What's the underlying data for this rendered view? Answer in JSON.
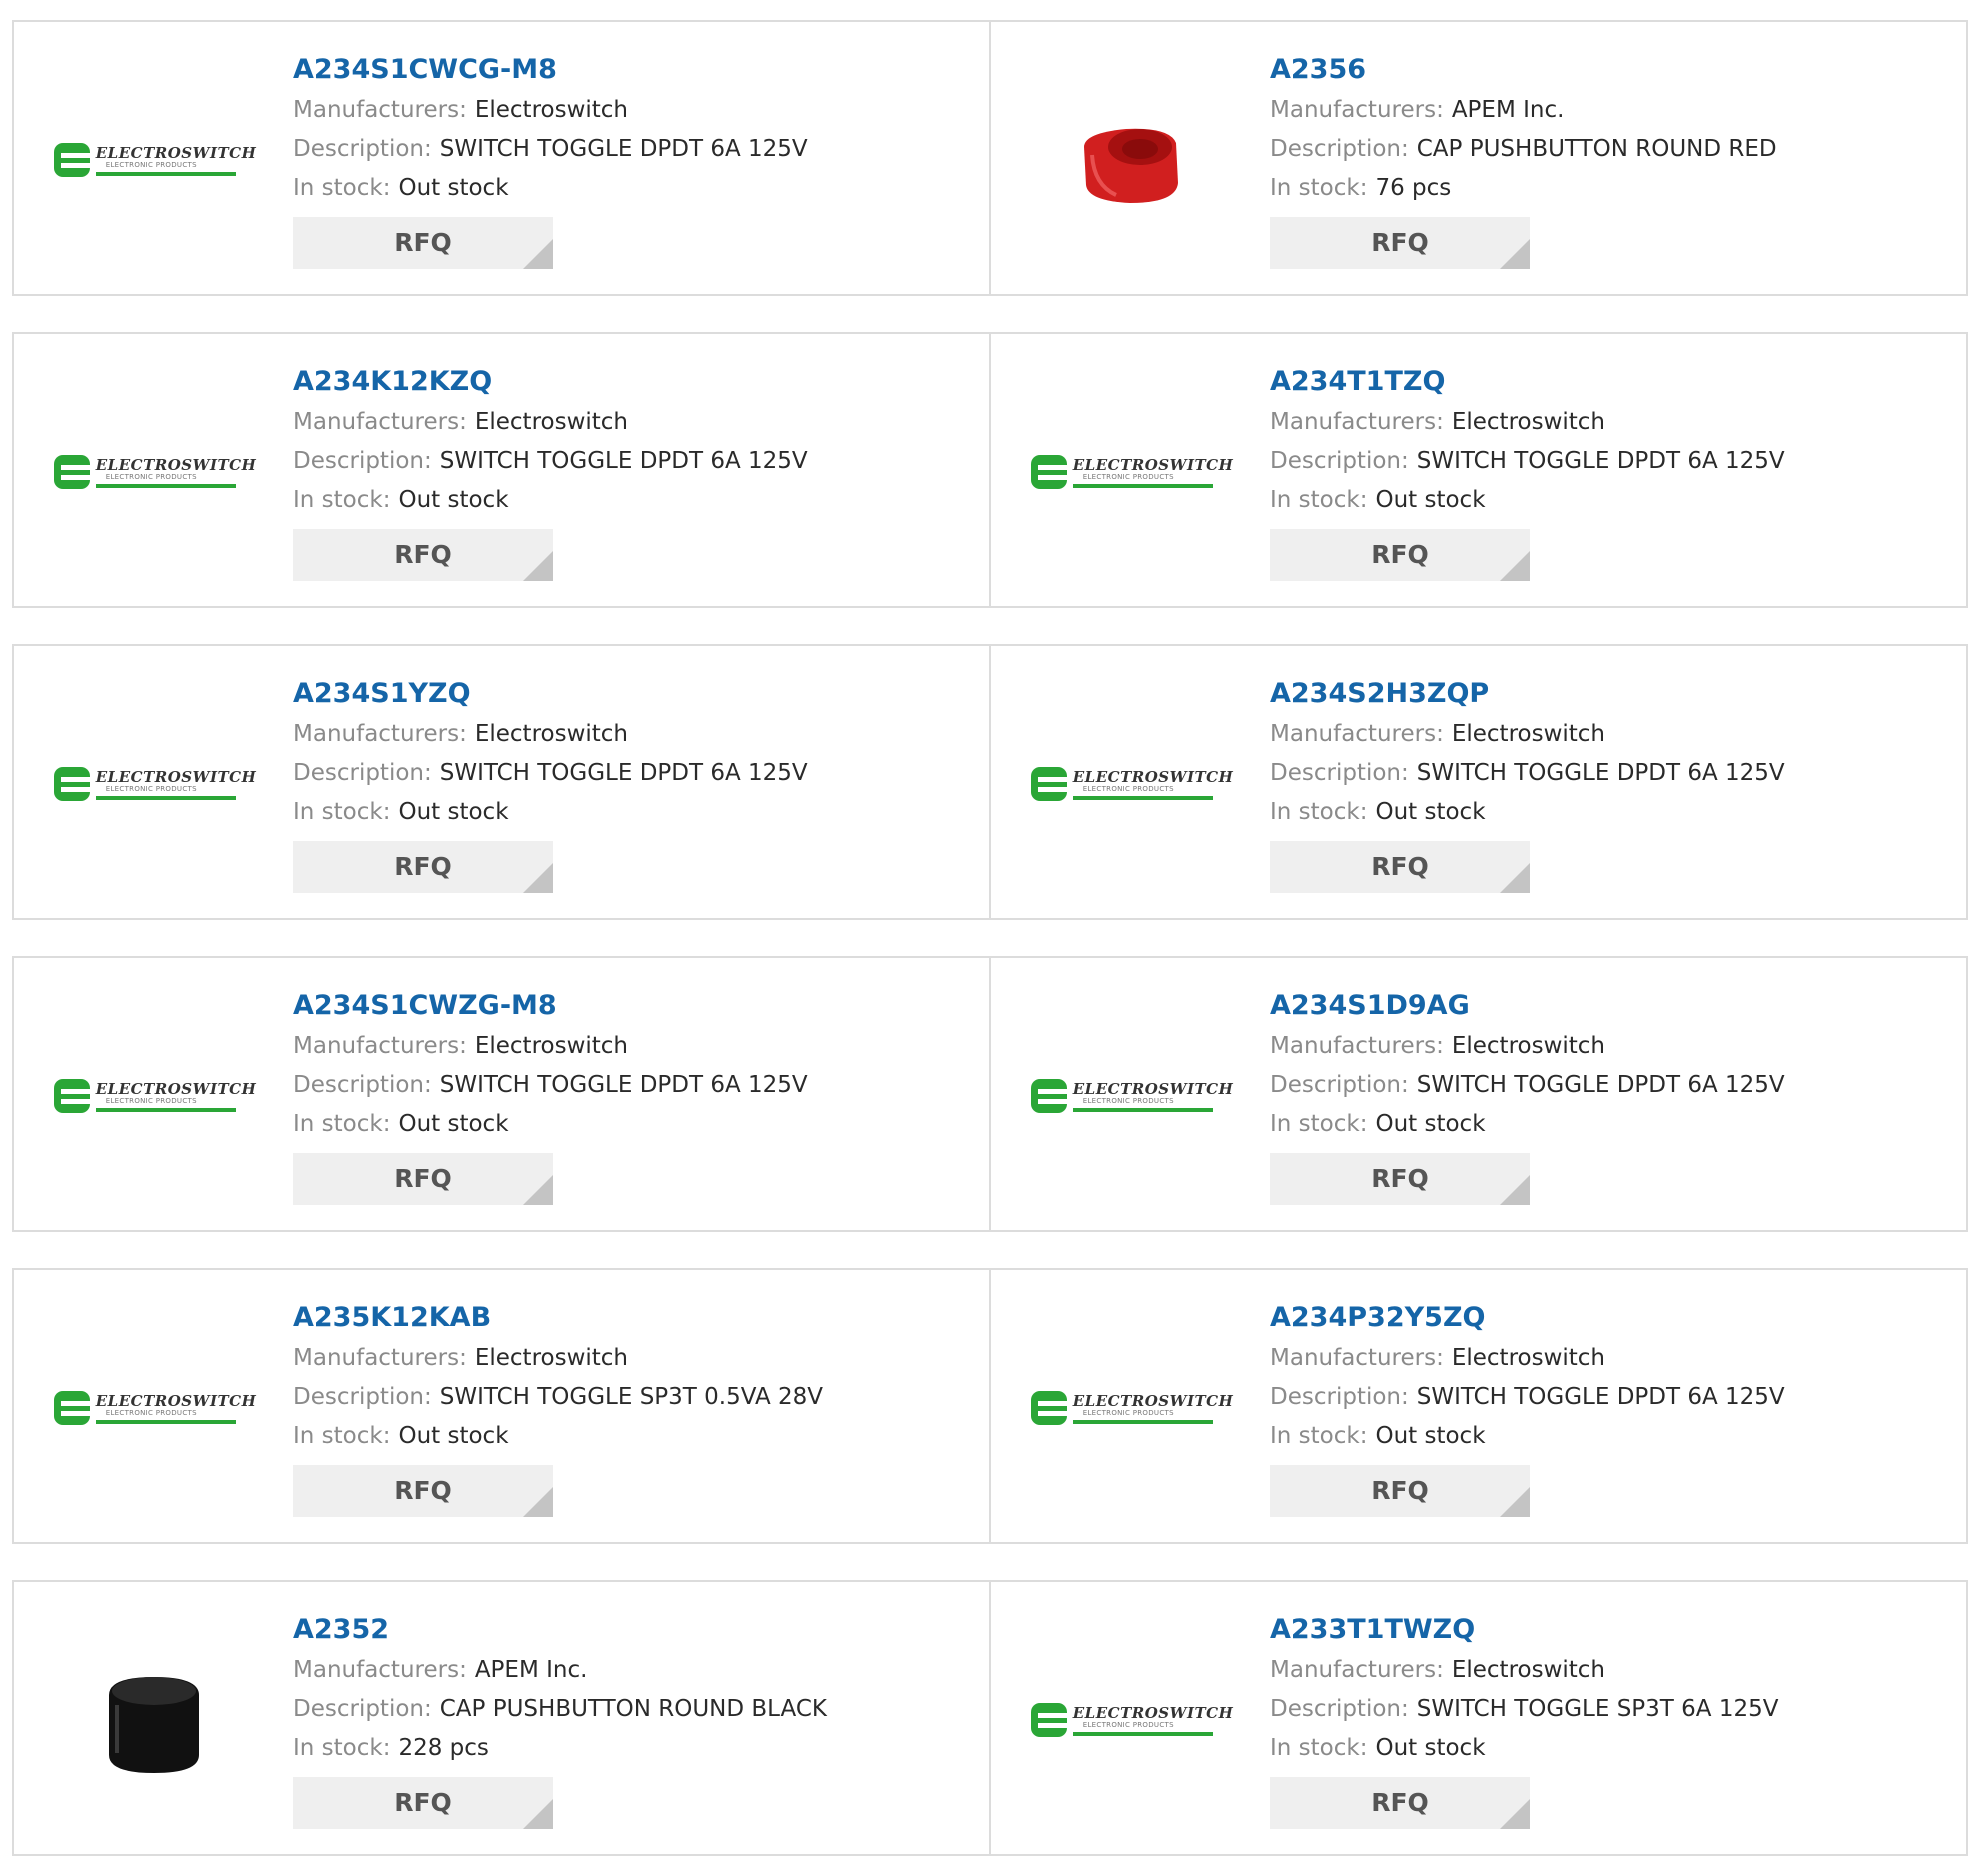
{
  "labels": {
    "manufacturers": "Manufacturers:",
    "description": "Description:",
    "in_stock": "In stock:",
    "rfq": "RFQ",
    "logo_word": "ELECTROSWITCH",
    "logo_sub": "ELECTRONIC PRODUCTS"
  },
  "colors": {
    "link": "#1565a8",
    "logo_green": "#2aa636",
    "red_cap": "#d11f1f",
    "black_cap": "#111111"
  },
  "products": [
    {
      "part": "A234S1CWCG-M8",
      "manufacturer": "Electroswitch",
      "description": "SWITCH TOGGLE DPDT 6A 125V",
      "stock": "Out stock",
      "image": "electroswitch-logo"
    },
    {
      "part": "A2356",
      "manufacturer": "APEM Inc.",
      "description": "CAP PUSHBUTTON ROUND RED",
      "stock": "76 pcs",
      "image": "red-cap"
    },
    {
      "part": "A234K12KZQ",
      "manufacturer": "Electroswitch",
      "description": "SWITCH TOGGLE DPDT 6A 125V",
      "stock": "Out stock",
      "image": "electroswitch-logo"
    },
    {
      "part": "A234T1TZQ",
      "manufacturer": "Electroswitch",
      "description": "SWITCH TOGGLE DPDT 6A 125V",
      "stock": "Out stock",
      "image": "electroswitch-logo"
    },
    {
      "part": "A234S1YZQ",
      "manufacturer": "Electroswitch",
      "description": "SWITCH TOGGLE DPDT 6A 125V",
      "stock": "Out stock",
      "image": "electroswitch-logo"
    },
    {
      "part": "A234S2H3ZQP",
      "manufacturer": "Electroswitch",
      "description": "SWITCH TOGGLE DPDT 6A 125V",
      "stock": "Out stock",
      "image": "electroswitch-logo"
    },
    {
      "part": "A234S1CWZG-M8",
      "manufacturer": "Electroswitch",
      "description": "SWITCH TOGGLE DPDT 6A 125V",
      "stock": "Out stock",
      "image": "electroswitch-logo"
    },
    {
      "part": "A234S1D9AG",
      "manufacturer": "Electroswitch",
      "description": "SWITCH TOGGLE DPDT 6A 125V",
      "stock": "Out stock",
      "image": "electroswitch-logo"
    },
    {
      "part": "A235K12KAB",
      "manufacturer": "Electroswitch",
      "description": "SWITCH TOGGLE SP3T 0.5VA 28V",
      "stock": "Out stock",
      "image": "electroswitch-logo"
    },
    {
      "part": "A234P32Y5ZQ",
      "manufacturer": "Electroswitch",
      "description": "SWITCH TOGGLE DPDT 6A 125V",
      "stock": "Out stock",
      "image": "electroswitch-logo"
    },
    {
      "part": "A2352",
      "manufacturer": "APEM Inc.",
      "description": "CAP PUSHBUTTON ROUND BLACK",
      "stock": "228 pcs",
      "image": "black-cap"
    },
    {
      "part": "A233T1TWZQ",
      "manufacturer": "Electroswitch",
      "description": "SWITCH TOGGLE SP3T 6A 125V",
      "stock": "Out stock",
      "image": "electroswitch-logo"
    }
  ]
}
